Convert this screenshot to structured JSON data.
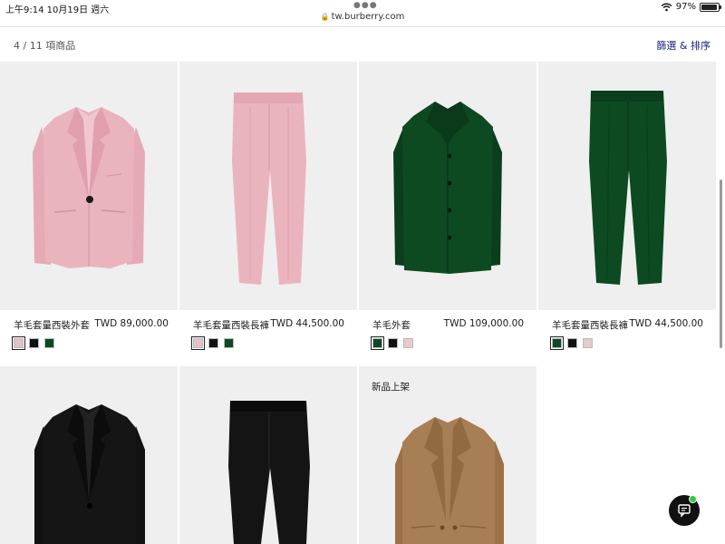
{
  "status_bar": {
    "time_date": "上午9:14   10月19日 週六",
    "url": "tw.burberry.com",
    "battery": "97%",
    "battery_level": 0.97
  },
  "toolbar": {
    "results_count": "4 / 11 項商品",
    "filter_sort": "篩選 & 排序"
  },
  "products": [
    {
      "name": "羊毛套量西裝外套",
      "price": "TWD 89,000.00",
      "swatches": [
        "#e3c1c5",
        "#111111",
        "#0c4a25"
      ],
      "selected_swatch": 0
    },
    {
      "name": "羊毛套量西裝長褲",
      "price": "TWD 44,500.00",
      "swatches": [
        "#e3c1c5",
        "#111111",
        "#0c4a25"
      ],
      "selected_swatch": 0
    },
    {
      "name": "羊毛外套",
      "price": "TWD 109,000.00",
      "swatches": [
        "#0c4a25",
        "#111111",
        "#e8c9cc"
      ],
      "selected_swatch": 0
    },
    {
      "name": "羊毛套量西裝長褲",
      "price": "TWD 44,500.00",
      "swatches": [
        "#0c4a25",
        "#111111",
        "#e8c9cc"
      ],
      "selected_swatch": 0
    }
  ],
  "second_row": {
    "new_badge": "新品上架"
  },
  "colors": {
    "pink": "#eab4be",
    "green": "#0d4a22",
    "black": "#151515",
    "camel": "#a87e55",
    "tile_bg": "#efefef",
    "link_blue": "#1a237e"
  },
  "icons": {
    "wifi": "wifi-icon",
    "battery": "battery-icon",
    "lock": "lock-icon",
    "chat": "chat-icon"
  }
}
